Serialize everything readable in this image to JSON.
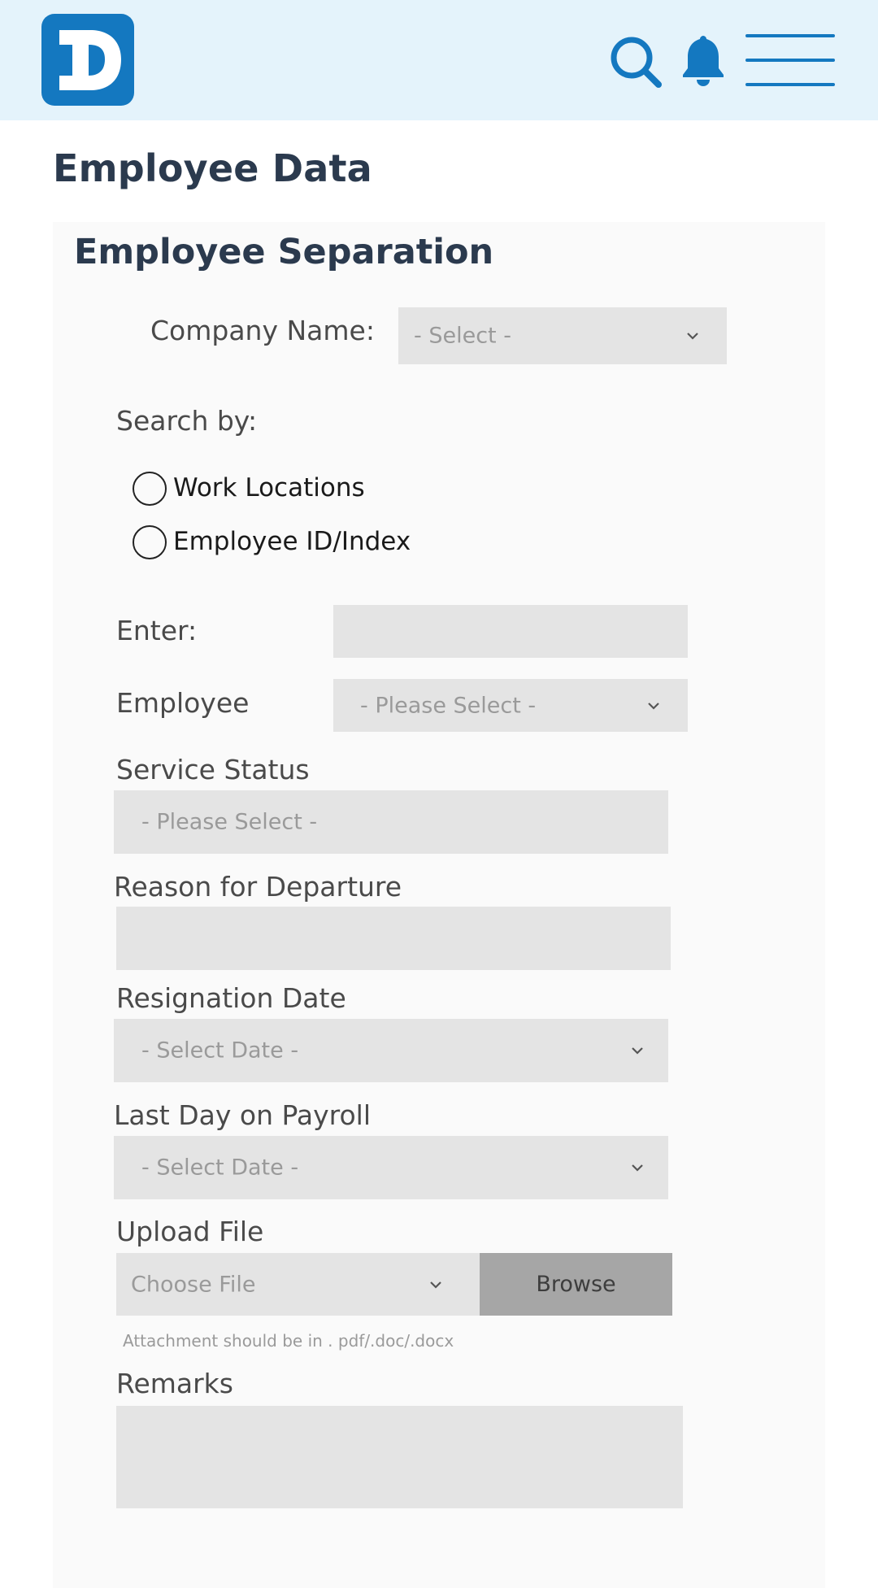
{
  "header": {
    "logo_letter": "D",
    "icons": {
      "search": "search-icon",
      "notifications": "bell-icon",
      "menu": "hamburger-menu-icon"
    },
    "accent_color": "#1478c0",
    "background_color": "#e4f3fb"
  },
  "page": {
    "title": "Employee Data"
  },
  "form": {
    "section_title": "Employee Separation",
    "company_name": {
      "label": "Company Name:",
      "selected": "- Select -"
    },
    "search_by": {
      "label": "Search by:",
      "options": [
        "Work Locations",
        "Employee ID/Index"
      ]
    },
    "enter": {
      "label": "Enter:",
      "value": ""
    },
    "employee": {
      "label": "Employee",
      "selected": "- Please Select -"
    },
    "service_status": {
      "label": "Service Status",
      "selected": "- Please Select -"
    },
    "reason_for_departure": {
      "label": "Reason for Departure",
      "value": ""
    },
    "resignation_date": {
      "label": "Resignation Date",
      "selected": "- Select Date -"
    },
    "last_day_on_payroll": {
      "label": "Last Day on Payroll",
      "selected": "- Select Date -"
    },
    "upload_file": {
      "label": "Upload File",
      "selected": "Choose File",
      "browse_label": "Browse",
      "hint": "Attachment should be in . pdf/.doc/.docx"
    },
    "remarks": {
      "label": "Remarks",
      "value": ""
    }
  }
}
